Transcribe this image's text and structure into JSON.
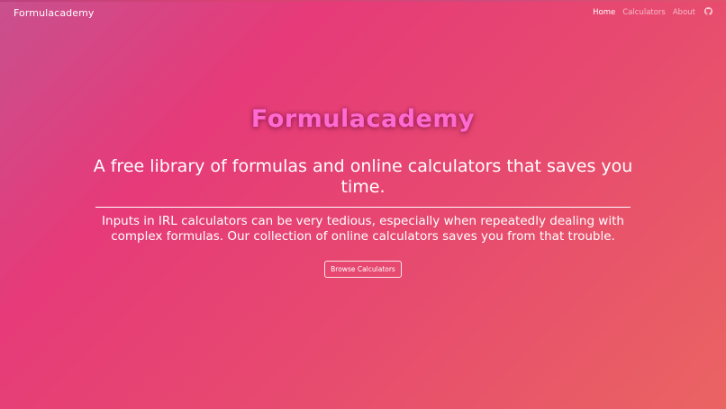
{
  "brand": "Formulacademy",
  "nav": {
    "items": [
      {
        "label": "Home",
        "active": true
      },
      {
        "label": "Calculators",
        "active": false
      },
      {
        "label": "About",
        "active": false
      }
    ],
    "github_icon": "github-icon"
  },
  "hero": {
    "title": "Formulacademy",
    "tagline": "A free library of formulas and online calculators that saves you time.",
    "description": "Inputs in IRL calculators can be very tedious, especially when repeatedly dealing with complex formulas. Our collection of online calculators saves you from that trouble.",
    "cta_label": "Browse Calculators"
  },
  "colors": {
    "gradient_start": "#c9508e",
    "gradient_mid": "#e63a79",
    "gradient_end": "#ea6462",
    "title_pink": "#ff6ad0",
    "text": "#ffffff"
  }
}
